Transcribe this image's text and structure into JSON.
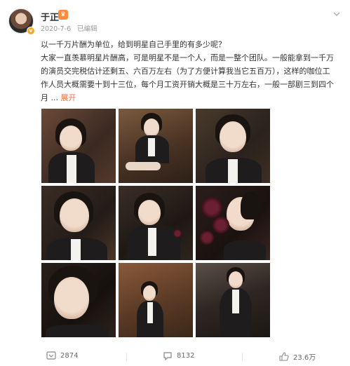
{
  "post": {
    "username": "于正",
    "date": "2020-7-6",
    "edited": "已编辑",
    "line1": "以一千万片酬为单位，给到明星自己手里的有多少呢？",
    "line2": "大家一直羡慕明星片酬高，可是明星不是一个人，而是一整个团队。一般能拿到一千万",
    "line3": "的演员交完税估计还剩五、六百万左右（为了方便计算我当它五百万），这样的咖位工",
    "line4": "作人员大概需要十到十三位，每个月工资开销大概是三十万左右，一般一部剧三到四个",
    "line5_prefix": "月 ... ",
    "expand_label": "展开"
  },
  "footer": {
    "repost_count": "2874",
    "comment_count": "8132",
    "like_count": "23.6万"
  },
  "colors": {
    "accent": "#eb7350",
    "muted": "#999999",
    "badge": "#f5a623"
  }
}
